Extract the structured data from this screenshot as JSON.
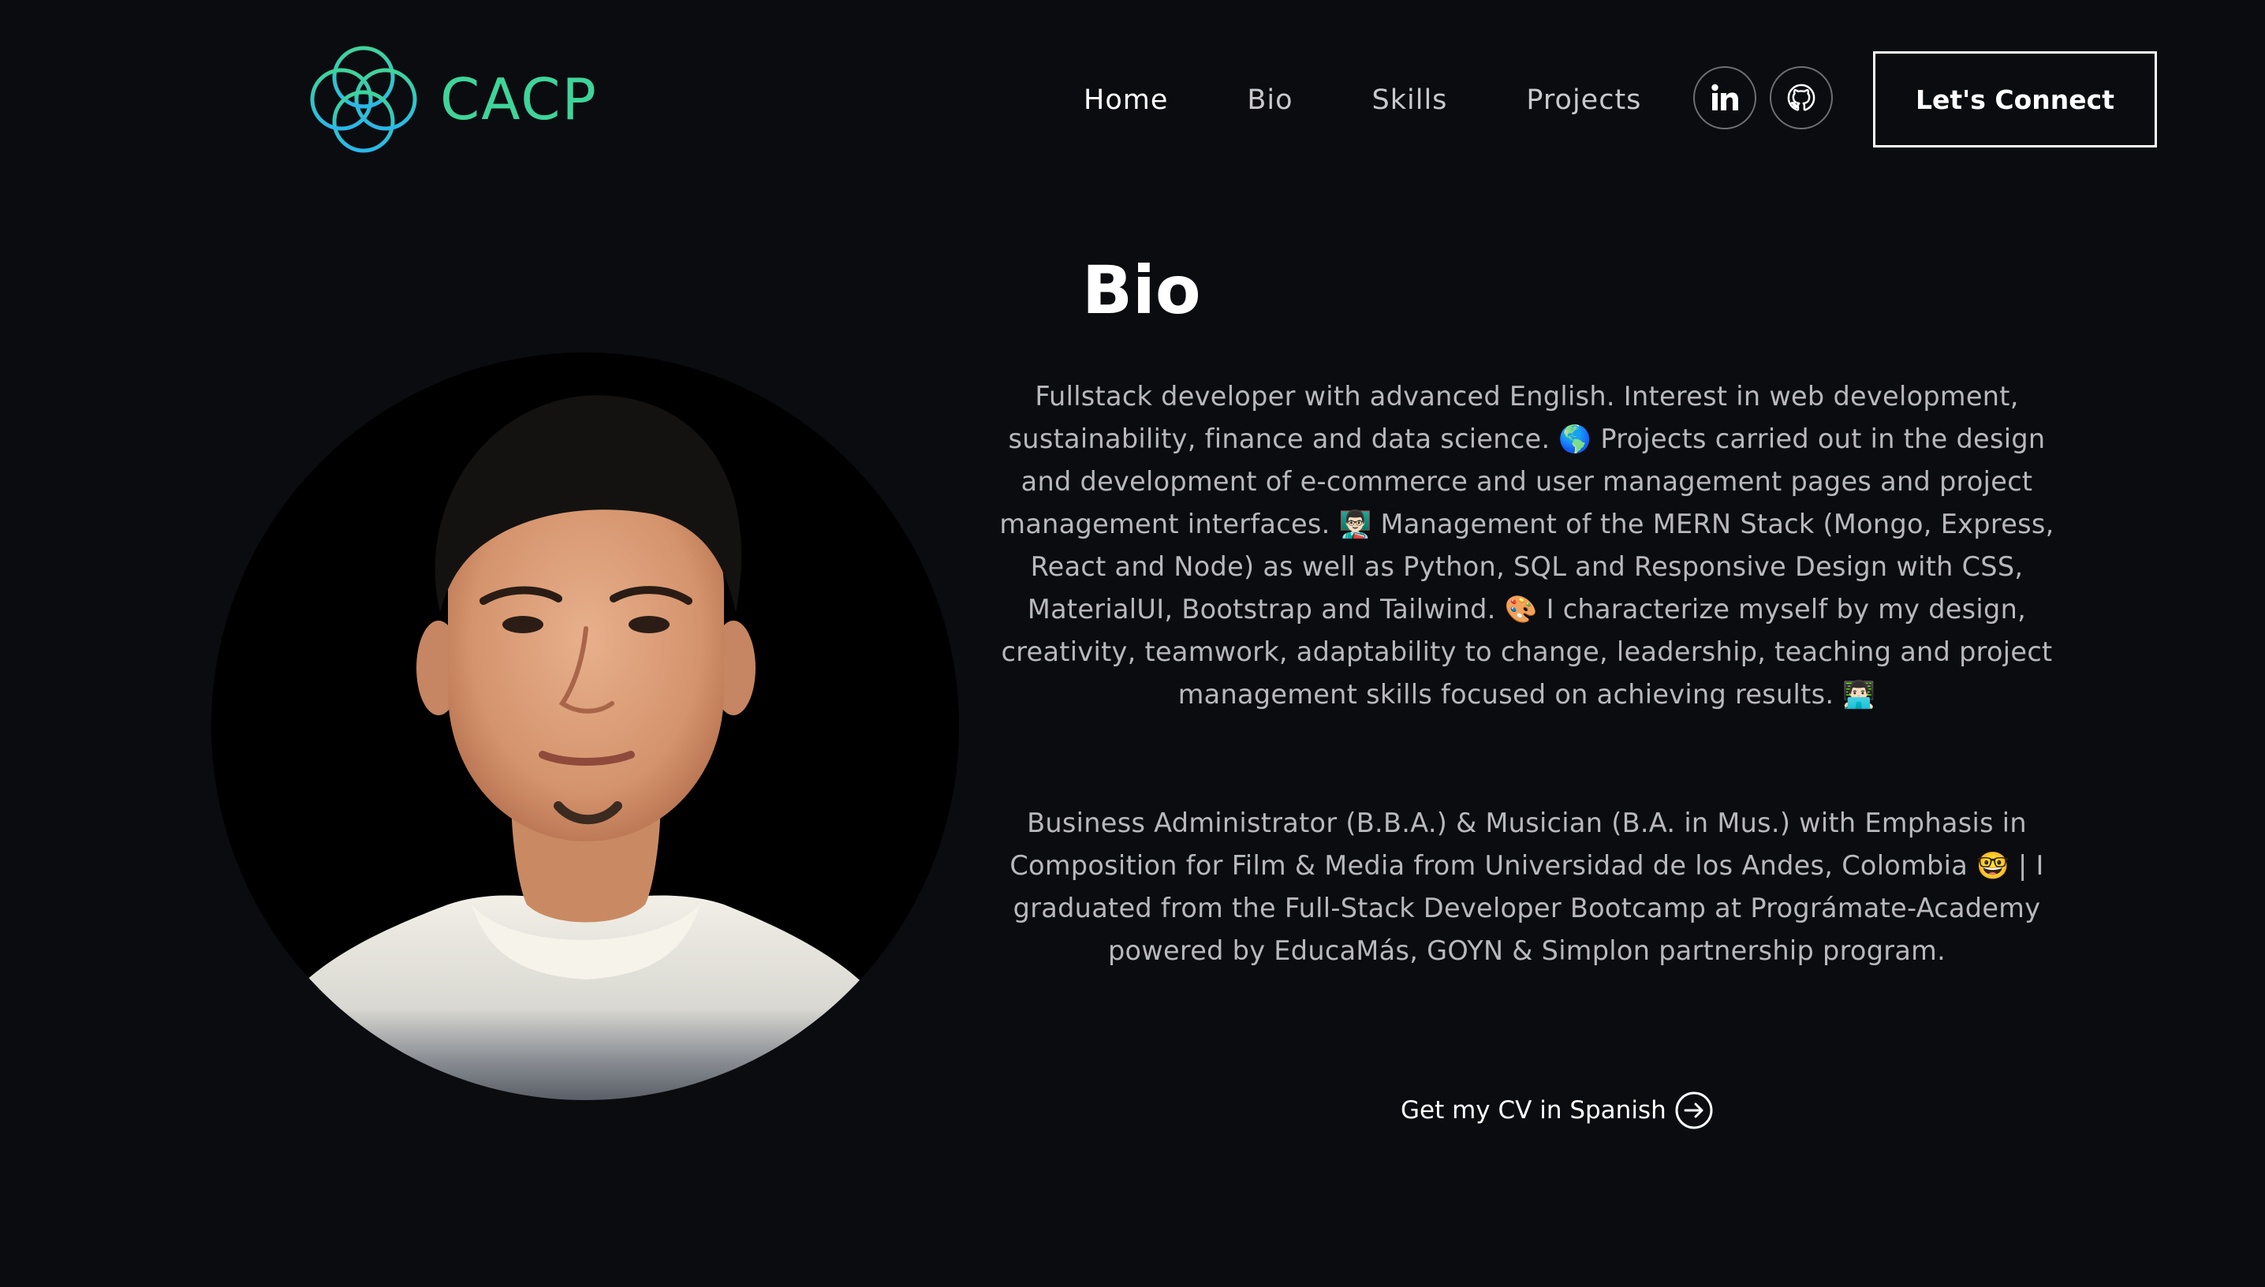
{
  "header": {
    "logo_text": "CACP",
    "nav": [
      {
        "label": "Home",
        "active": true
      },
      {
        "label": "Bio",
        "active": false
      },
      {
        "label": "Skills",
        "active": false
      },
      {
        "label": "Projects",
        "active": false
      }
    ],
    "social": [
      {
        "name": "linkedin-icon",
        "label": "in"
      },
      {
        "name": "github-icon",
        "label": ""
      }
    ],
    "cta_label": "Let's Connect"
  },
  "bio": {
    "title": "Bio",
    "paragraph_1": "Fullstack developer with advanced English. Interest in web development, sustainability, finance and data science. 🌎 Projects carried out in the design and development of e-commerce and user management pages and project management interfaces. 👨🏻‍🏫 Management of the MERN Stack (Mongo, Express, React and Node) as well as Python, SQL and Responsive Design with CSS, MaterialUI, Bootstrap and Tailwind. 🎨 I characterize myself by my design, creativity, teamwork, adaptability to change, leadership, teaching and project management skills focused on achieving results. 👨🏻‍💻",
    "paragraph_2": "Business Administrator (B.B.A.) & Musician (B.A. in Mus.) with Emphasis in Composition for Film & Media from Universidad de los Andes, Colombia 🤓 | I graduated from the Full-Stack Developer Bootcamp at Prográmate-Academy powered by EducaMás, GOYN & Simplon partnership program.",
    "cv_link_label": "Get my CV in Spanish"
  },
  "colors": {
    "background": "#0b0c10",
    "accent_green": "#3fd49a",
    "accent_blue": "#2ab7e8",
    "text_primary": "#ffffff",
    "text_muted": "#b8b8bd"
  }
}
